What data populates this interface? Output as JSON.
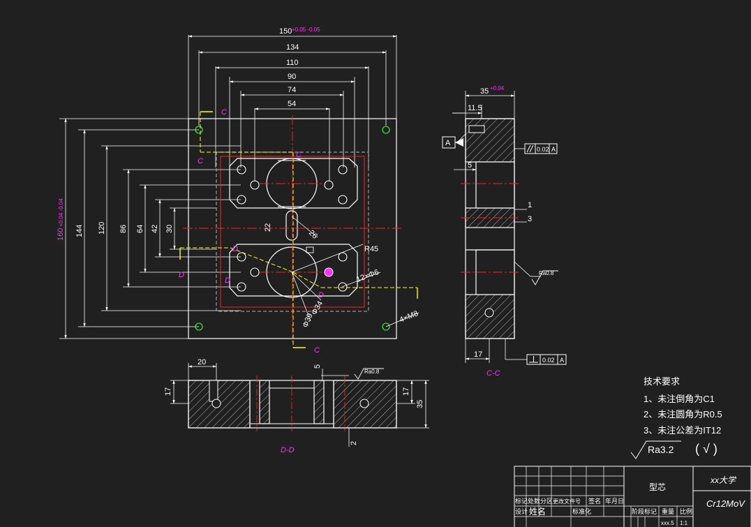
{
  "dimensions": {
    "width_150": "150",
    "width_150_tol": "+0.05 -0.05",
    "w134": "134",
    "w110": "110",
    "w90": "90",
    "w74": "74",
    "w54": "54",
    "height_160": "160",
    "height_160_tol": "+0.04 -0.04",
    "h144": "144",
    "h120": "120",
    "h86": "86",
    "h64": "64",
    "h42": "42",
    "h30": "30",
    "d22": "22",
    "d26": "26",
    "r45": "R45",
    "holes_12_d6": "12×Φ6",
    "thread_4_m8": "4×M8",
    "d34": "Φ34",
    "d39": "Φ39",
    "side_35": "35",
    "side_35_tol": "+0.04",
    "side_11_5": "11.5",
    "side_5": "5",
    "side_1": "1",
    "side_3": "3",
    "side_17": "17",
    "bottom_20": "20",
    "bottom_5": "5",
    "bottom_17_left": "17",
    "bottom_17_right": "17",
    "bottom_35": "35",
    "bottom_2": "2"
  },
  "section_labels": {
    "c": "C",
    "d": "D",
    "cc": "C-C",
    "dd": "D-D",
    "datum_a": "A"
  },
  "tolerances": {
    "parallel_value": "0.02",
    "parallel_datum": "A",
    "perp_value": "0.02",
    "perp_datum": "A",
    "roughness_side": "Ra0.8",
    "roughness_bottom": "Ra0.8"
  },
  "notes": {
    "title": "技术要求",
    "item1": "1、未注倒角为C1",
    "item2": "2、未注圆角为R0.5",
    "item3": "3、未注公差为IT12",
    "roughness": "Ra3.2",
    "roughness_bracket": "( √ )"
  },
  "title_block": {
    "part_name": "型芯",
    "school": "xx大学",
    "material": "Cr12MoV",
    "h_mark": "标记",
    "h_qty": "处数",
    "h_zone": "分区",
    "h_change": "更改文件号",
    "h_sign": "签名",
    "h_date": "年月日",
    "h_design": "设计",
    "h_name": "姓名",
    "h_standard": "标准化",
    "h_stage": "阶段标记",
    "h_weight": "重量",
    "h_scale": "比例",
    "scale_value": "1:1",
    "weight_value": "xxx.5"
  },
  "colors": {
    "background": "#202020",
    "outline": "#ffffff",
    "hatch": "#c8c8c8",
    "center": "#ff2020",
    "yellow": "#ffff00",
    "magenta": "#ff33ff",
    "green": "#33ff33",
    "hidden": "#9a9a9a"
  }
}
